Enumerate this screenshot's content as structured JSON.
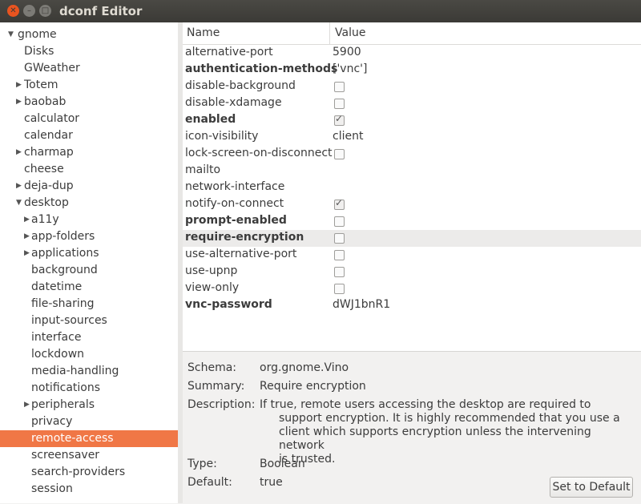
{
  "window": {
    "title": "dconf Editor"
  },
  "tree": {
    "items": [
      {
        "label": "gnome",
        "expanded": true,
        "hasChildren": true,
        "level": 0
      },
      {
        "label": "Disks",
        "hasChildren": false,
        "level": 1
      },
      {
        "label": "GWeather",
        "hasChildren": false,
        "level": 1
      },
      {
        "label": "Totem",
        "hasChildren": true,
        "level": 1
      },
      {
        "label": "baobab",
        "hasChildren": true,
        "level": 1
      },
      {
        "label": "calculator",
        "hasChildren": false,
        "level": 1
      },
      {
        "label": "calendar",
        "hasChildren": false,
        "level": 1
      },
      {
        "label": "charmap",
        "hasChildren": true,
        "level": 1
      },
      {
        "label": "cheese",
        "hasChildren": false,
        "level": 1
      },
      {
        "label": "deja-dup",
        "hasChildren": true,
        "level": 1
      },
      {
        "label": "desktop",
        "expanded": true,
        "hasChildren": true,
        "level": 1
      },
      {
        "label": "a11y",
        "hasChildren": true,
        "level": 2
      },
      {
        "label": "app-folders",
        "hasChildren": true,
        "level": 2
      },
      {
        "label": "applications",
        "hasChildren": true,
        "level": 2
      },
      {
        "label": "background",
        "hasChildren": false,
        "level": 2
      },
      {
        "label": "datetime",
        "hasChildren": false,
        "level": 2
      },
      {
        "label": "file-sharing",
        "hasChildren": false,
        "level": 2
      },
      {
        "label": "input-sources",
        "hasChildren": false,
        "level": 2
      },
      {
        "label": "interface",
        "hasChildren": false,
        "level": 2
      },
      {
        "label": "lockdown",
        "hasChildren": false,
        "level": 2
      },
      {
        "label": "media-handling",
        "hasChildren": false,
        "level": 2
      },
      {
        "label": "notifications",
        "hasChildren": false,
        "level": 2
      },
      {
        "label": "peripherals",
        "hasChildren": true,
        "level": 2
      },
      {
        "label": "privacy",
        "hasChildren": false,
        "level": 2
      },
      {
        "label": "remote-access",
        "hasChildren": false,
        "level": 2,
        "selected": true
      },
      {
        "label": "screensaver",
        "hasChildren": false,
        "level": 2
      },
      {
        "label": "search-providers",
        "hasChildren": false,
        "level": 2
      },
      {
        "label": "session",
        "hasChildren": false,
        "level": 2
      }
    ]
  },
  "keys": {
    "columns": {
      "name": "Name",
      "value": "Value"
    },
    "rows": [
      {
        "name": "alternative-port",
        "bold": false,
        "type": "text",
        "value": "5900"
      },
      {
        "name": "authentication-methods",
        "bold": true,
        "type": "text",
        "value": "['vnc']"
      },
      {
        "name": "disable-background",
        "bold": false,
        "type": "check",
        "checked": false
      },
      {
        "name": "disable-xdamage",
        "bold": false,
        "type": "check",
        "checked": false
      },
      {
        "name": "enabled",
        "bold": true,
        "type": "check",
        "checked": true
      },
      {
        "name": "icon-visibility",
        "bold": false,
        "type": "text",
        "value": "client"
      },
      {
        "name": "lock-screen-on-disconnect",
        "bold": false,
        "type": "check",
        "checked": false
      },
      {
        "name": "mailto",
        "bold": false,
        "type": "text",
        "value": ""
      },
      {
        "name": "network-interface",
        "bold": false,
        "type": "text",
        "value": ""
      },
      {
        "name": "notify-on-connect",
        "bold": false,
        "type": "check",
        "checked": true
      },
      {
        "name": "prompt-enabled",
        "bold": true,
        "type": "check",
        "checked": false
      },
      {
        "name": "require-encryption",
        "bold": true,
        "type": "check",
        "checked": false,
        "highlighted": true
      },
      {
        "name": "use-alternative-port",
        "bold": false,
        "type": "check",
        "checked": false
      },
      {
        "name": "use-upnp",
        "bold": false,
        "type": "check",
        "checked": false
      },
      {
        "name": "view-only",
        "bold": false,
        "type": "check",
        "checked": false
      },
      {
        "name": "vnc-password",
        "bold": true,
        "type": "text",
        "value": "dWJ1bnR1"
      }
    ]
  },
  "details": {
    "schema_label": "Schema:",
    "schema": "org.gnome.Vino",
    "summary_label": "Summary:",
    "summary": "Require encryption",
    "description_label": "Description:",
    "description_lines": [
      "If true, remote users accessing the desktop are required to",
      "support encryption. It is highly recommended that you use a",
      "client which supports encryption unless the intervening network",
      "is trusted."
    ],
    "type_label": "Type:",
    "type": "Boolean",
    "default_label": "Default:",
    "default": "true",
    "set_default_label": "Set to Default"
  }
}
